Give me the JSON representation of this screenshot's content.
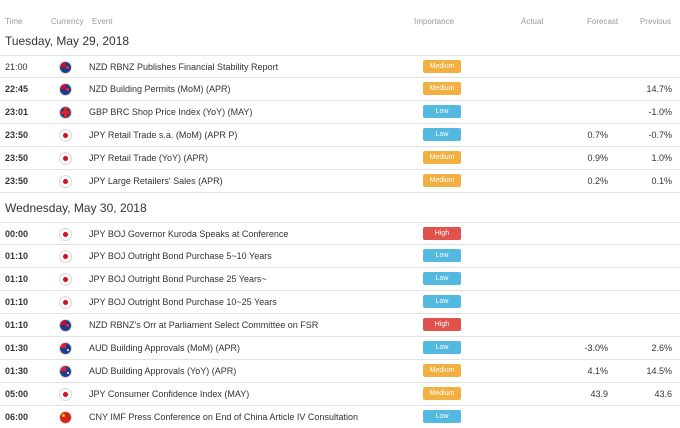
{
  "header": {
    "time": "Time",
    "currency": "Currency",
    "event": "Event",
    "importance": "Importance",
    "actual": "Actual",
    "forecast": "Forecast",
    "previous": "Previous"
  },
  "days": [
    {
      "label": "Tuesday, May 29, 2018",
      "rows": [
        {
          "time": "21:00",
          "bold": false,
          "currency": "NZD",
          "flag_icon": "new-zealand-flag-icon",
          "event": "NZD RBNZ Publishes Financial Stability Report",
          "importance": "Medium",
          "actual": "",
          "forecast": "",
          "previous": ""
        },
        {
          "time": "22:45",
          "bold": true,
          "currency": "NZD",
          "flag_icon": "new-zealand-flag-icon",
          "event": "NZD Building Permits (MoM) (APR)",
          "importance": "Medium",
          "actual": "",
          "forecast": "",
          "previous": "14.7%"
        },
        {
          "time": "23:01",
          "bold": true,
          "currency": "GBP",
          "flag_icon": "united-kingdom-flag-icon",
          "event": "GBP BRC Shop Price Index (YoY) (MAY)",
          "importance": "Low",
          "actual": "",
          "forecast": "",
          "previous": "-1.0%"
        },
        {
          "time": "23:50",
          "bold": true,
          "currency": "JPY",
          "flag_icon": "japan-flag-icon",
          "event": "JPY Retail Trade s.a. (MoM) (APR P)",
          "importance": "Low",
          "actual": "",
          "forecast": "0.7%",
          "previous": "-0.7%"
        },
        {
          "time": "23:50",
          "bold": true,
          "currency": "JPY",
          "flag_icon": "japan-flag-icon",
          "event": "JPY Retail Trade (YoY) (APR)",
          "importance": "Medium",
          "actual": "",
          "forecast": "0.9%",
          "previous": "1.0%"
        },
        {
          "time": "23:50",
          "bold": true,
          "currency": "JPY",
          "flag_icon": "japan-flag-icon",
          "event": "JPY Large Retailers' Sales (APR)",
          "importance": "Medium",
          "actual": "",
          "forecast": "0.2%",
          "previous": "0.1%"
        }
      ]
    },
    {
      "label": "Wednesday, May 30, 2018",
      "rows": [
        {
          "time": "00:00",
          "bold": true,
          "currency": "JPY",
          "flag_icon": "japan-flag-icon",
          "event": "JPY BOJ Governor Kuroda Speaks at Conference",
          "importance": "High",
          "actual": "",
          "forecast": "",
          "previous": ""
        },
        {
          "time": "01:10",
          "bold": true,
          "currency": "JPY",
          "flag_icon": "japan-flag-icon",
          "event": "JPY BOJ Outright Bond Purchase 5~10 Years",
          "importance": "Low",
          "actual": "",
          "forecast": "",
          "previous": ""
        },
        {
          "time": "01:10",
          "bold": true,
          "currency": "JPY",
          "flag_icon": "japan-flag-icon",
          "event": "JPY BOJ Outright Bond Purchase 25 Years~",
          "importance": "Low",
          "actual": "",
          "forecast": "",
          "previous": ""
        },
        {
          "time": "01:10",
          "bold": true,
          "currency": "JPY",
          "flag_icon": "japan-flag-icon",
          "event": "JPY BOJ Outright Bond Purchase 10~25 Years",
          "importance": "Low",
          "actual": "",
          "forecast": "",
          "previous": ""
        },
        {
          "time": "01:10",
          "bold": true,
          "currency": "NZD",
          "flag_icon": "new-zealand-flag-icon",
          "event": "NZD RBNZ's Orr at Parliament Select Committee on FSR",
          "importance": "High",
          "actual": "",
          "forecast": "",
          "previous": ""
        },
        {
          "time": "01:30",
          "bold": true,
          "currency": "AUD",
          "flag_icon": "australia-flag-icon",
          "event": "AUD Building Approvals (MoM) (APR)",
          "importance": "Low",
          "actual": "",
          "forecast": "-3.0%",
          "previous": "2.6%"
        },
        {
          "time": "01:30",
          "bold": true,
          "currency": "AUD",
          "flag_icon": "australia-flag-icon",
          "event": "AUD Building Approvals (YoY) (APR)",
          "importance": "Medium",
          "actual": "",
          "forecast": "4.1%",
          "previous": "14.5%"
        },
        {
          "time": "05:00",
          "bold": true,
          "currency": "JPY",
          "flag_icon": "japan-flag-icon",
          "event": "JPY Consumer Confidence Index (MAY)",
          "importance": "Medium",
          "actual": "",
          "forecast": "43.9",
          "previous": "43.6"
        },
        {
          "time": "06:00",
          "bold": true,
          "currency": "CNY",
          "flag_icon": "china-flag-icon",
          "event": "CNY IMF Press Conference on End of China Article IV Consultation",
          "importance": "Low",
          "actual": "",
          "forecast": "",
          "previous": ""
        }
      ]
    }
  ],
  "colors": {
    "Medium": "#f3b042",
    "Low": "#54b9e1",
    "High": "#e2524d"
  }
}
